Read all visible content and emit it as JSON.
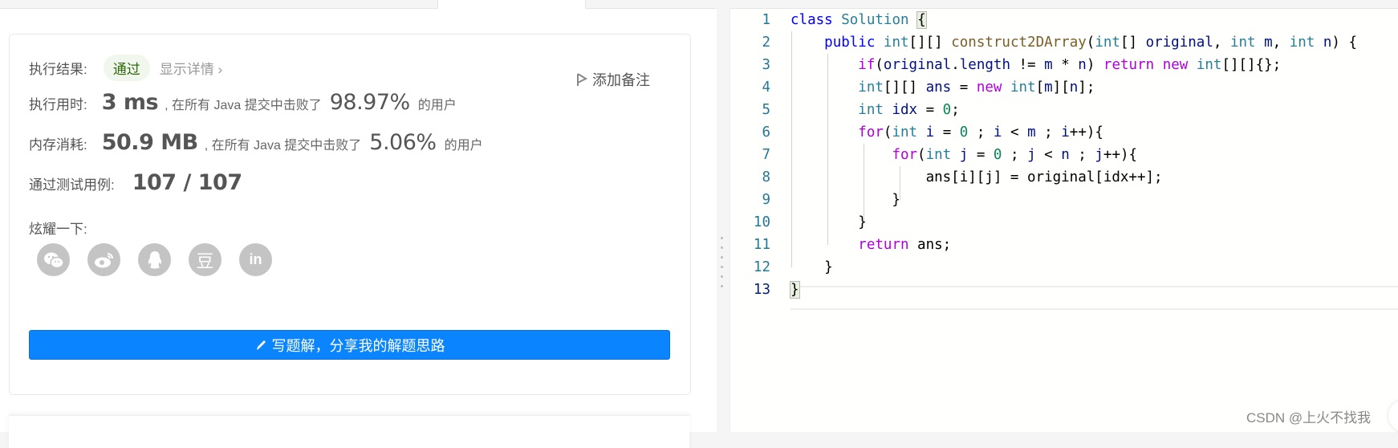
{
  "result": {
    "exec_result_label": "执行结果:",
    "status_badge": "通过",
    "show_details": "显示详情 ›",
    "add_note": "添加备注",
    "runtime_label": "执行用时:",
    "runtime_value": "3 ms",
    "runtime_text": ", 在所有 Java 提交中击败了",
    "runtime_percent": "98.97%",
    "runtime_suffix": "的用户",
    "memory_label": "内存消耗:",
    "memory_value": "50.9 MB",
    "memory_text": ", 在所有 Java 提交中击败了",
    "memory_percent": "5.06%",
    "memory_suffix": "的用户",
    "testcases_label": "通过测试用例:",
    "testcases_value": "107 / 107",
    "share_label": "炫耀一下:",
    "share_icons": [
      "wechat-icon",
      "weibo-icon",
      "qq-icon",
      "douban-icon",
      "linkedin-icon"
    ],
    "douban_glyph": "豆",
    "linkedin_glyph": "in",
    "write_solution": "写题解，分享我的解题思路"
  },
  "editor": {
    "line_numbers": [
      "1",
      "2",
      "3",
      "4",
      "5",
      "6",
      "7",
      "8",
      "9",
      "10",
      "11",
      "12",
      "13"
    ],
    "current_line": 13
  },
  "watermark": "CSDN @上火不找我",
  "colors": {
    "accent": "#0a84ff",
    "badge_bg": "#f2f7ee",
    "badge_text": "#2d6a0b"
  }
}
